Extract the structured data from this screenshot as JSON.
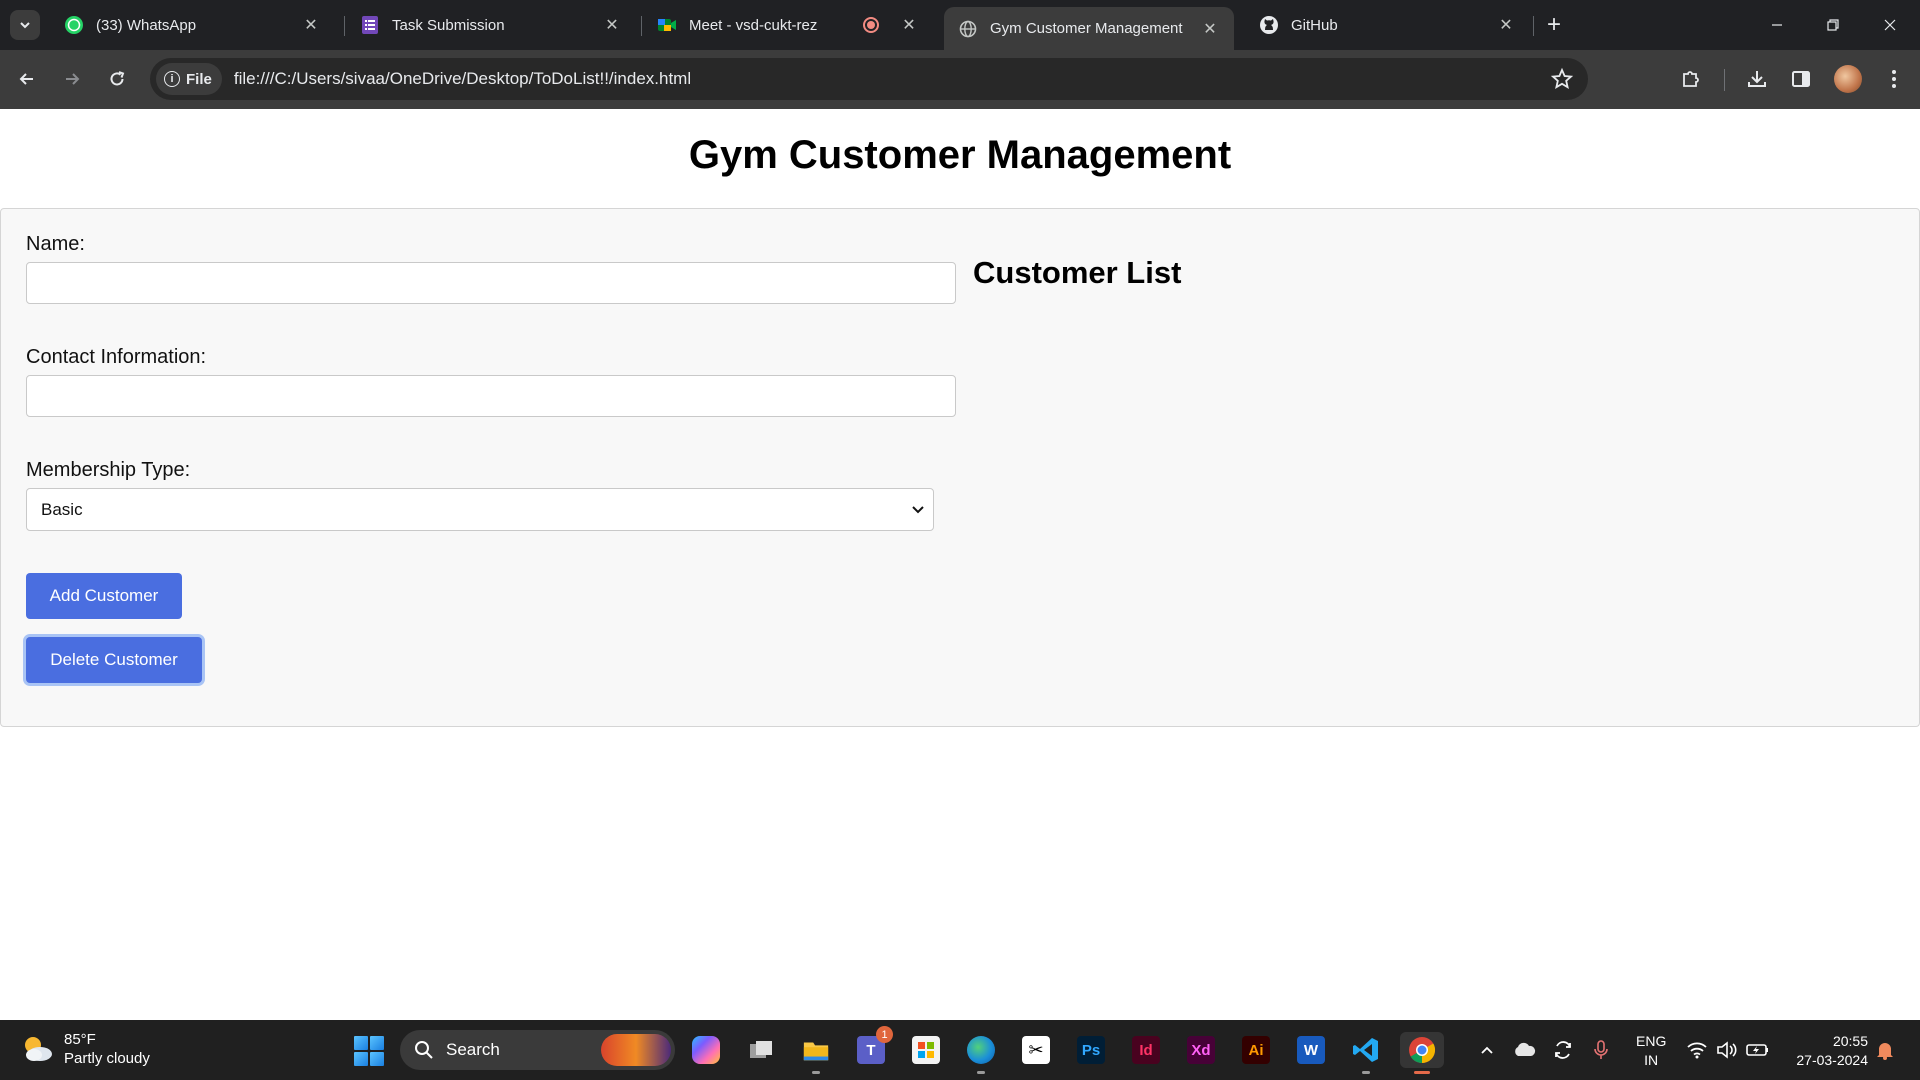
{
  "browser": {
    "tabs": [
      {
        "title": "(33) WhatsApp",
        "badge": "33"
      },
      {
        "title": "Task Submission"
      },
      {
        "title": "Meet - vsd-cukt-rez"
      },
      {
        "title": "Gym Customer Management"
      },
      {
        "title": "GitHub"
      }
    ],
    "active_tab": 3,
    "security_chip": "File",
    "url": "file:///C:/Users/sivaa/OneDrive/Desktop/ToDoList!!/index.html"
  },
  "page": {
    "title": "Gym Customer Management",
    "form": {
      "name_label": "Name:",
      "name_value": "",
      "contact_label": "Contact Information:",
      "contact_value": "",
      "membership_label": "Membership Type:",
      "membership_selected": "Basic",
      "add_button": "Add Customer",
      "delete_button": "Delete Customer"
    },
    "list_title": "Customer List"
  },
  "taskbar": {
    "weather_temp": "85°F",
    "weather_desc": "Partly cloudy",
    "search_label": "Search",
    "teams_badge": "1",
    "lang_top": "ENG",
    "lang_bottom": "IN",
    "time": "20:55",
    "date": "27-03-2024",
    "apps": [
      "copilot-icon",
      "task-view-icon",
      "file-explorer-icon",
      "teams-icon",
      "microsoft-store-icon",
      "edge-icon",
      "capcut-icon",
      "photoshop-icon",
      "indesign-icon",
      "xd-icon",
      "illustrator-icon",
      "word-icon",
      "vscode-icon",
      "chrome-icon"
    ]
  },
  "colors": {
    "accent_button": "#4a6ee0",
    "panel_bg": "#f8f8f8",
    "chrome_dark": "#202124"
  }
}
